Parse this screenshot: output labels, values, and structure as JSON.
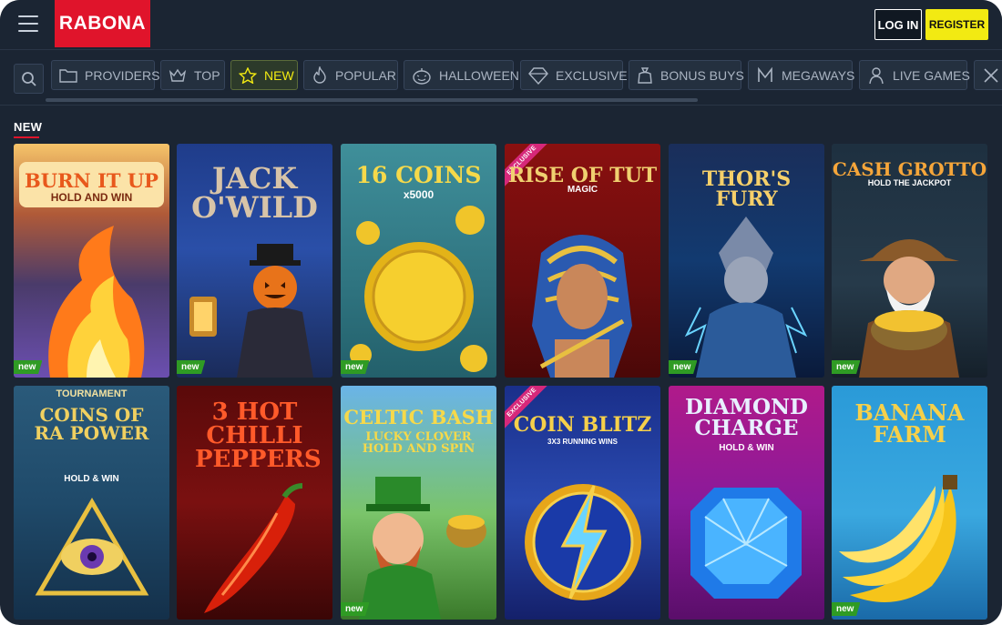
{
  "header": {
    "logo": "RABONA",
    "login_label": "LOG IN",
    "register_label": "REGISTER"
  },
  "categories": [
    {
      "label": "PROVIDERS",
      "icon": "folder-icon"
    },
    {
      "label": "TOP",
      "icon": "crown-icon"
    },
    {
      "label": "NEW",
      "icon": "star-icon",
      "active": true
    },
    {
      "label": "POPULAR",
      "icon": "flame-icon"
    },
    {
      "label": "HALLOWEEN",
      "icon": "pumpkin-icon"
    },
    {
      "label": "EXCLUSIVE",
      "icon": "gem-icon"
    },
    {
      "label": "BONUS BUYS",
      "icon": "bag-icon"
    },
    {
      "label": "MEGAWAYS",
      "icon": "megaways-icon"
    },
    {
      "label": "LIVE GAMES",
      "icon": "dealer-icon"
    }
  ],
  "section": {
    "title": "NEW"
  },
  "games": [
    {
      "title": "BURN IT UP",
      "subtitle": "HOLD AND WIN",
      "badge": "new"
    },
    {
      "title": "JACK O'WILD",
      "subtitle": "",
      "badge": "new"
    },
    {
      "title": "16 COINS",
      "subtitle": "x5000",
      "badge": "new"
    },
    {
      "title": "RISE OF TUT",
      "subtitle": "MAGIC",
      "badge": "EXCLUSIVE"
    },
    {
      "title": "THOR'S FURY",
      "subtitle": "",
      "badge": "new"
    },
    {
      "title": "CASH GROTTO",
      "subtitle": "HOLD THE JACKPOT",
      "badge": "new"
    },
    {
      "title": "COINS OF RA POWER",
      "subtitle": "HOLD & WIN",
      "pretitle": "TOURNAMENT",
      "badge": ""
    },
    {
      "title": "3 HOT CHILLI PEPPERS",
      "subtitle": "",
      "badge": ""
    },
    {
      "title": "CELTIC BASH",
      "subtitle": "LUCKY CLOVER HOLD AND SPIN",
      "badge": "new"
    },
    {
      "title": "COIN BLITZ",
      "subtitle": "3X3 RUNNING WINS",
      "badge": "EXCLUSIVE"
    },
    {
      "title": "DIAMOND CHARGE",
      "subtitle": "HOLD & WIN",
      "badge": ""
    },
    {
      "title": "BANANA FARM",
      "subtitle": "",
      "badge": "new"
    }
  ],
  "colors": {
    "accent": "#f2ea12",
    "brand": "#e0142b",
    "badge_new": "#2f9b24",
    "badge_exclusive": "#d6287a"
  }
}
